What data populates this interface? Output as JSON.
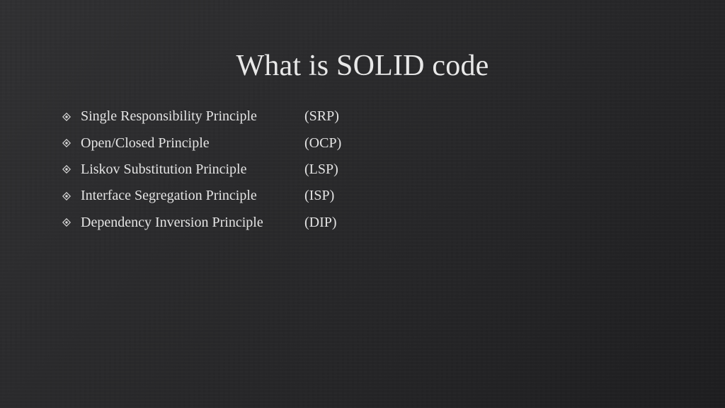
{
  "slide": {
    "title": "What is SOLID code",
    "bullet_icon": "diamond-dot-icon",
    "items": [
      {
        "principle": "Single Responsibility Principle",
        "abbreviation": "(SRP)"
      },
      {
        "principle": "Open/Closed Principle",
        "abbreviation": "(OCP)"
      },
      {
        "principle": "Liskov Substitution Principle",
        "abbreviation": "(LSP)"
      },
      {
        "principle": "Interface Segregation Principle",
        "abbreviation": "(ISP)"
      },
      {
        "principle": "Dependency Inversion Principle",
        "abbreviation": "(DIP)"
      }
    ]
  },
  "colors": {
    "background_light": "#313133",
    "background_dark": "#1e1e20",
    "text": "#e6e6e6"
  }
}
